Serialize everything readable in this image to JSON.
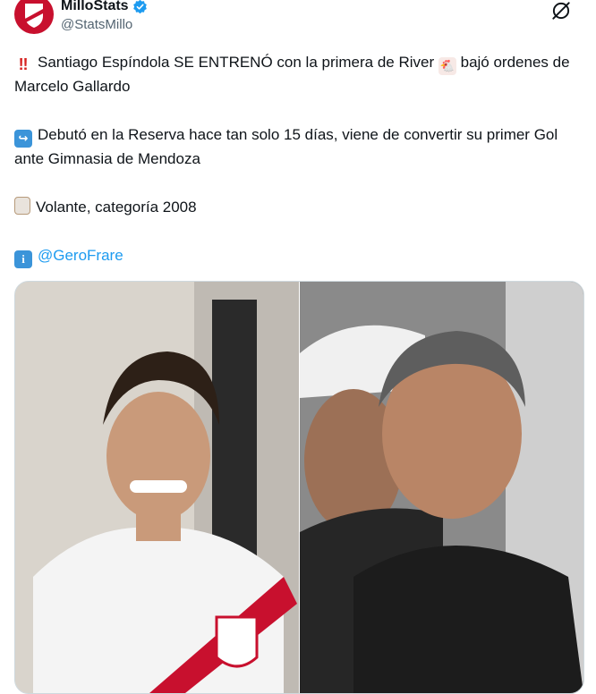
{
  "account": {
    "display_name": "MilloStats",
    "handle": "@StatsMillo"
  },
  "tweet": {
    "p1_text": "Santiago Espíndola SE ENTRENÓ con la primera de River",
    "p1_text_b": " bajó ordenes de Marcelo Gallardo",
    "p2_text": "Debutó en la Reserva hace tan solo 15 días, viene de convertir su primer Gol ante Gimnasia de Mendoza",
    "p3_text": "Volante, categoría 2008",
    "p4_mention": "@GeroFrare"
  },
  "icons": {
    "p1": "double-exclamation-icon",
    "chicken": "chicken-icon",
    "p2": "return-arrow-icon",
    "p3": "clipboard-icon",
    "p4": "info-icon",
    "verified": "verified-badge-icon",
    "grok": "grok-icon"
  },
  "colors": {
    "accent": "#1d9bf0",
    "text": "#0f1419",
    "secondary": "#536471",
    "river_red": "#c8102e"
  }
}
